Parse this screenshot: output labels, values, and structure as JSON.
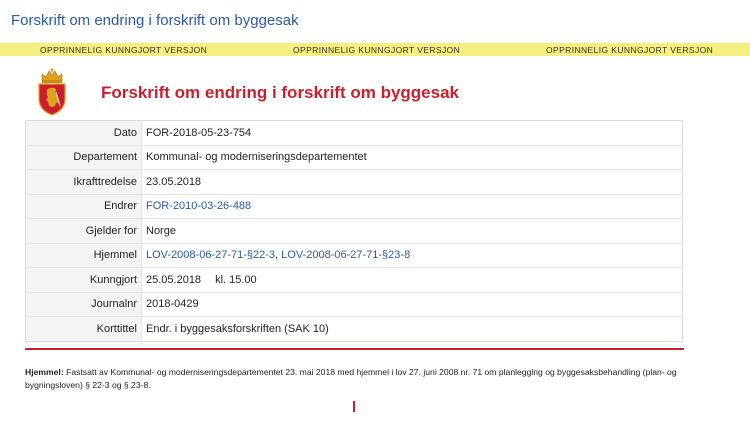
{
  "header": {
    "title": "Forskrift om endring i forskrift om byggesak"
  },
  "banner": {
    "items": [
      "OPPRINNELIG KUNNGJORT VERSJON",
      "OPPRINNELIG KUNNGJORT VERSJON",
      "OPPRINNELIG KUNNGJORT VERSJON"
    ]
  },
  "document": {
    "title": "Forskrift om endring i forskrift om byggesak"
  },
  "colors": {
    "accent_red": "#cc1f2d",
    "link_blue": "#2b5aa6",
    "banner_yellow": "#f4ef7e"
  },
  "icons": {
    "crest": "norwegian-coat-of-arms-icon"
  },
  "metadata": {
    "dato": {
      "label": "Dato",
      "value": "FOR-2018-05-23-754"
    },
    "departement": {
      "label": "Departement",
      "value": "Kommunal- og moderniseringsdepartementet"
    },
    "ikrafttredelse": {
      "label": "Ikrafttredelse",
      "value": "23.05.2018"
    },
    "endrer": {
      "label": "Endrer",
      "value": "FOR-2010-03-26-488"
    },
    "gjelder": {
      "label": "Gjelder for",
      "value": "Norge"
    },
    "hjemmel": {
      "label": "Hjemmel",
      "link1": "LOV-2008-06-27-71-§22-3",
      "sep": ", ",
      "link2": "LOV-2008-06-27-71-§23-8"
    },
    "kunngjort": {
      "label": "Kunngjort",
      "date": "25.05.2018",
      "time": "kl. 15.00"
    },
    "journalnr": {
      "label": "Journalnr",
      "value": "2018-0429"
    },
    "korttittel": {
      "label": "Korttittel",
      "value": "Endr. i byggesaksforskriften (SAK 10)"
    }
  },
  "footnote": {
    "label": "Hjemmel:",
    "text": " Fastsatt av Kommunal- og moderniseringsdepartementet 23. mai 2018 med hjemmel i lov 27. juni 2008 nr. 71 om planlegging og byggesaksbehandling (plan- og bygningsloven) § 22-3 og § 23-8."
  }
}
